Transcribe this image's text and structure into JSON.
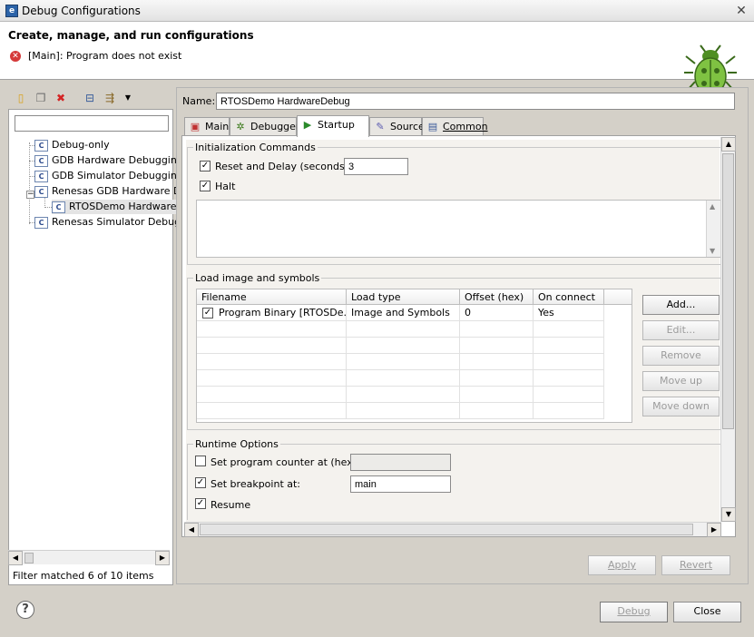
{
  "window": {
    "title": "Debug Configurations",
    "close_glyph": "✕"
  },
  "header": {
    "title": "Create, manage, and run configurations",
    "error_message": "[Main]: Program does not exist"
  },
  "left": {
    "toolbar": [
      "new-config-icon",
      "duplicate-icon",
      "delete-icon",
      "collapse-all-icon",
      "filter-icon",
      "dropdown-icon"
    ],
    "filter_placeholder": "",
    "tree": [
      {
        "label": "Debug-only",
        "level": 1
      },
      {
        "label": "GDB Hardware Debugging",
        "level": 1
      },
      {
        "label": "GDB Simulator Debugging (",
        "level": 1
      },
      {
        "label": "Renesas GDB Hardware De",
        "level": 1,
        "expanded": true
      },
      {
        "label": "RTOSDemo HardwareD",
        "level": 2,
        "selected": true
      },
      {
        "label": "Renesas Simulator Debugg",
        "level": 1
      }
    ],
    "status": "Filter matched 6 of 10 items"
  },
  "name": {
    "label": "Name:",
    "value": "RTOSDemo HardwareDebug"
  },
  "tabs": [
    {
      "label": "Main",
      "icon": "main-tab-icon"
    },
    {
      "label": "Debugger",
      "icon": "debugger-tab-icon"
    },
    {
      "label": "Startup",
      "icon": "startup-tab-icon",
      "active": true
    },
    {
      "label": "Source",
      "icon": "source-tab-icon"
    },
    {
      "label": "Common",
      "icon": "common-tab-icon"
    }
  ],
  "init": {
    "title": "Initialization Commands",
    "reset_label": "Reset and Delay (seconds):",
    "reset_checked": true,
    "delay_value": "3",
    "halt_label": "Halt",
    "halt_checked": true,
    "commands_text": ""
  },
  "load": {
    "title": "Load image and symbols",
    "columns": [
      "Filename",
      "Load type",
      "Offset (hex)",
      "On connect"
    ],
    "rows": [
      {
        "checked": true,
        "filename": "Program Binary [RTOSDe...",
        "load_type": "Image and Symbols",
        "offset": "0",
        "on_connect": "Yes"
      }
    ],
    "buttons": {
      "add": "Add...",
      "edit": "Edit...",
      "remove": "Remove",
      "move_up": "Move up",
      "move_down": "Move down"
    }
  },
  "runtime": {
    "title": "Runtime Options",
    "pc_label": "Set program counter at (hex):",
    "pc_checked": false,
    "pc_value": "",
    "bp_label": "Set breakpoint at:",
    "bp_checked": true,
    "bp_value": "main",
    "resume_label": "Resume",
    "resume_checked": true
  },
  "actions": {
    "apply": "Apply",
    "revert": "Revert",
    "debug": "Debug",
    "close": "Close"
  },
  "help_glyph": "?"
}
